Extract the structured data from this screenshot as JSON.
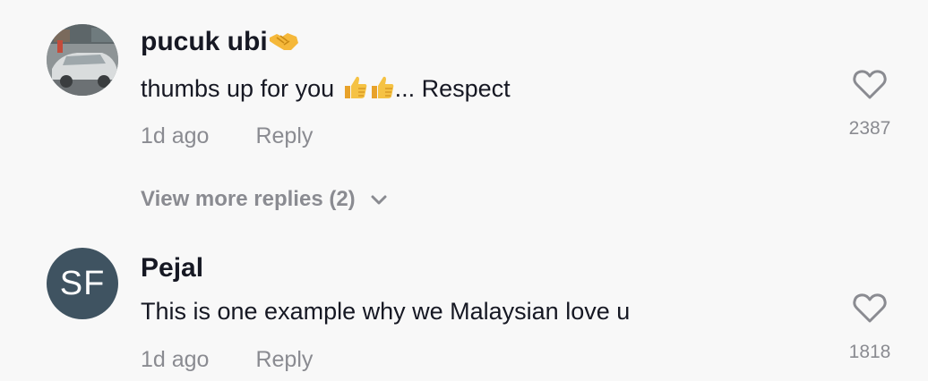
{
  "comments": [
    {
      "username": "pucuk ubi",
      "username_emoji": "handshake-icon",
      "text_before": "thumbs up for you ",
      "text_emojis": [
        "thumbs-up-icon",
        "thumbs-up-icon"
      ],
      "text_after": "... Respect",
      "time": "1d ago",
      "reply_label": "Reply",
      "likes": "2387",
      "avatar": "car-photo"
    },
    {
      "username": "Pejal",
      "text": "This is one example why we Malaysian love u",
      "time": "1d ago",
      "reply_label": "Reply",
      "likes": "1818",
      "avatar_initials": "SF"
    }
  ],
  "view_more_replies": "View more replies (2)",
  "colors": {
    "background": "#f8f8f8",
    "text": "#161823",
    "muted": "#8a8b91",
    "avatar_initials_bg": "#3f5361"
  }
}
